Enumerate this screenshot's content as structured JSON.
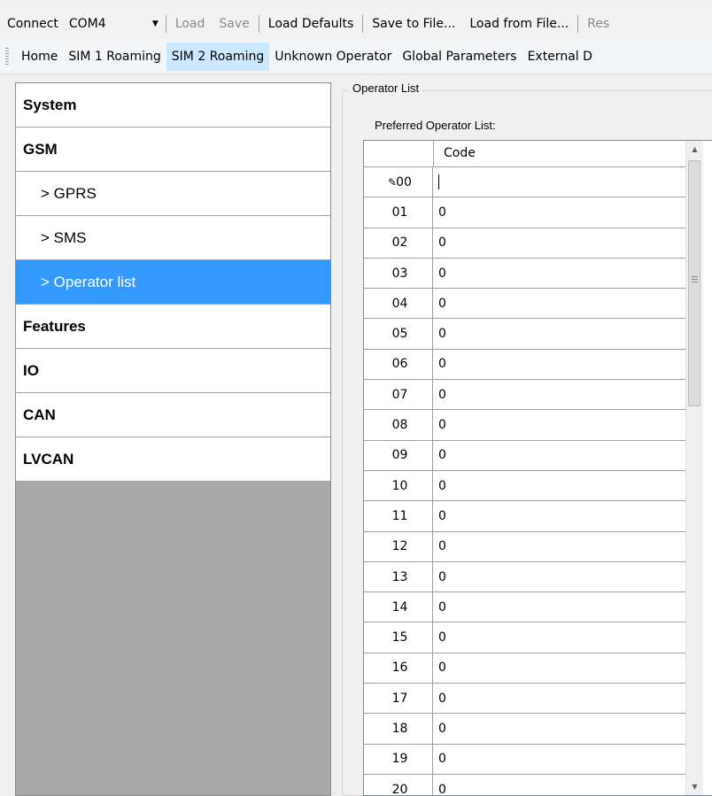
{
  "toolbar1": {
    "connect_label": "Connect",
    "port_value": "COM4",
    "load_label": "Load",
    "save_label": "Save",
    "load_defaults_label": "Load Defaults",
    "save_to_file_label": "Save to File...",
    "load_from_file_label": "Load from File...",
    "reset_label": "Res"
  },
  "tabs": [
    {
      "label": "Home"
    },
    {
      "label": "SIM 1 Roaming"
    },
    {
      "label": "SIM 2 Roaming"
    },
    {
      "label": "Unknown Operator"
    },
    {
      "label": "Global Parameters"
    },
    {
      "label": "External D"
    }
  ],
  "active_tab": "SIM 2 Roaming",
  "nav": [
    {
      "label": "System"
    },
    {
      "label": "GSM"
    },
    {
      "label": "> GPRS"
    },
    {
      "label": "> SMS"
    },
    {
      "label": "> Operator list"
    },
    {
      "label": "Features"
    },
    {
      "label": "IO"
    },
    {
      "label": "CAN"
    },
    {
      "label": "LVCAN"
    }
  ],
  "selected_nav": "> Operator list",
  "operator_list": {
    "group_title": "Operator List",
    "preferred_label": "Preferred Operator List:",
    "column_header": "Code",
    "rows": [
      {
        "index": "00",
        "code": ""
      },
      {
        "index": "01",
        "code": "0"
      },
      {
        "index": "02",
        "code": "0"
      },
      {
        "index": "03",
        "code": "0"
      },
      {
        "index": "04",
        "code": "0"
      },
      {
        "index": "05",
        "code": "0"
      },
      {
        "index": "06",
        "code": "0"
      },
      {
        "index": "07",
        "code": "0"
      },
      {
        "index": "08",
        "code": "0"
      },
      {
        "index": "09",
        "code": "0"
      },
      {
        "index": "10",
        "code": "0"
      },
      {
        "index": "11",
        "code": "0"
      },
      {
        "index": "12",
        "code": "0"
      },
      {
        "index": "13",
        "code": "0"
      },
      {
        "index": "14",
        "code": "0"
      },
      {
        "index": "15",
        "code": "0"
      },
      {
        "index": "16",
        "code": "0"
      },
      {
        "index": "17",
        "code": "0"
      },
      {
        "index": "18",
        "code": "0"
      },
      {
        "index": "19",
        "code": "0"
      },
      {
        "index": "20",
        "code": "0"
      }
    ]
  },
  "colors": {
    "selection": "#3399ff",
    "active_tab": "#cce8ff"
  },
  "icons": {
    "port_dropdown": "chevron-down-icon",
    "editing_row": "pencil-icon"
  }
}
